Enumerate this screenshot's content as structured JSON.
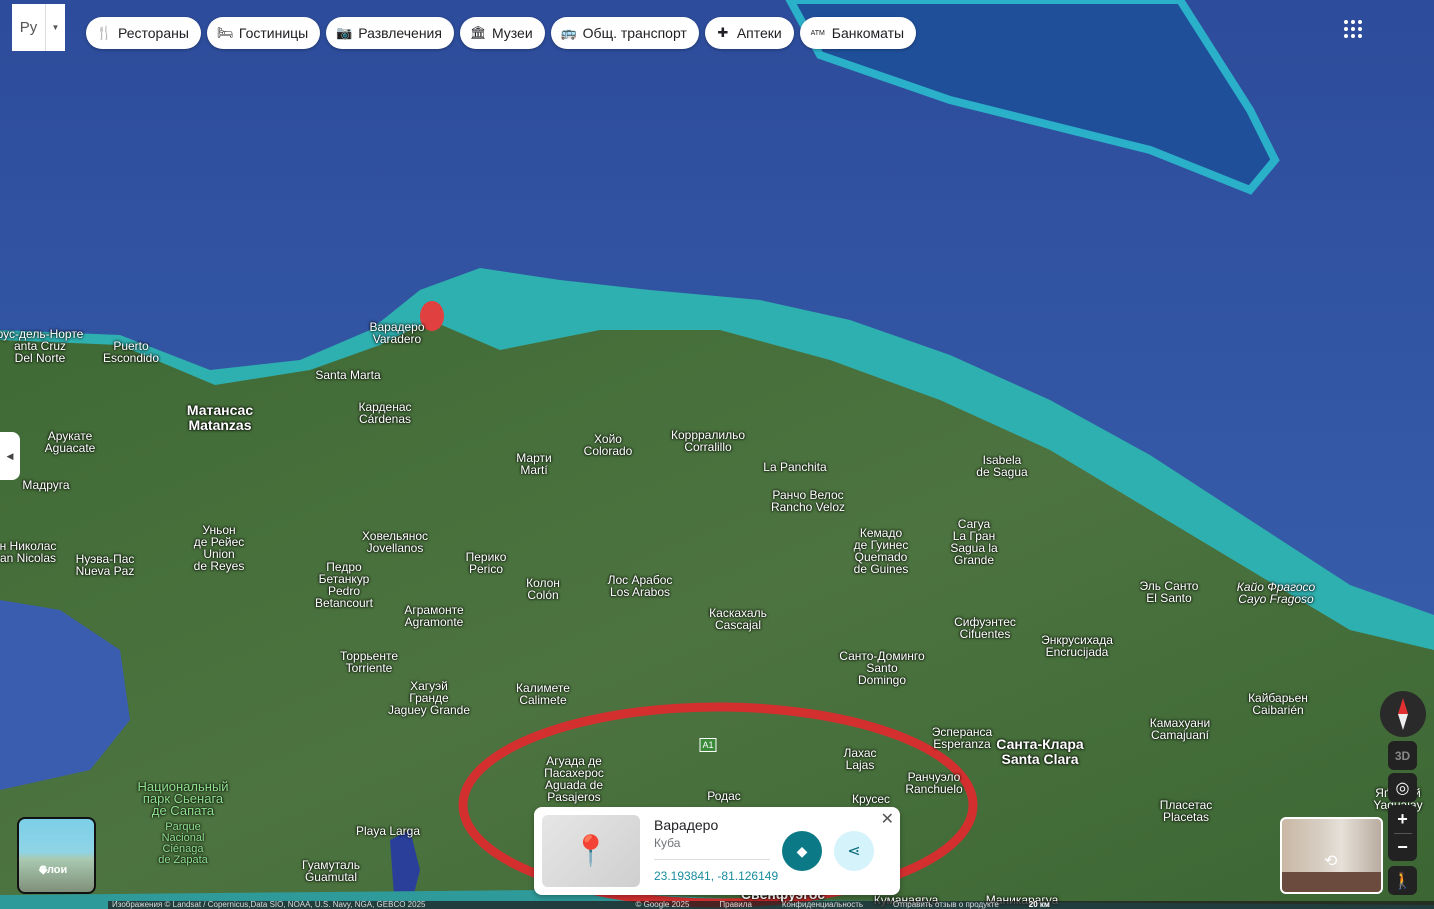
{
  "language": {
    "value": "Ру"
  },
  "categories": [
    {
      "label": "Рестораны",
      "icon": "fork-knife-icon"
    },
    {
      "label": "Гостиницы",
      "icon": "bed-icon"
    },
    {
      "label": "Развлечения",
      "icon": "camera-icon"
    },
    {
      "label": "Музеи",
      "icon": "museum-icon"
    },
    {
      "label": "Общ. транспорт",
      "icon": "bus-icon"
    },
    {
      "label": "Аптеки",
      "icon": "pharmacy-icon"
    },
    {
      "label": "Банкоматы",
      "icon": "atm-icon"
    }
  ],
  "labels": [
    "Варадеро\nVaradero",
    "Матансас\nMatanzas",
    "Santa Marta",
    "Карденас\nCárdenas",
    "Puerto\nEscondido",
    "Хойо\nColorado",
    "Коррралильо\nCorralillo",
    "Марти\nMartí",
    "La Panchita",
    "Isabela\nde Sagua",
    "Ранчо Велос\nRancho Veloz",
    "Кемадо\nде Гуинес\nQuemado\nde Guines",
    "Сагуа\nLa Гран\nSagua la\nGrande",
    "Арукате\nAguacate",
    "Мадруга",
    "Уньон\nде Рейес\nUnion\nde Reyes",
    "Нуэва-Пас\nNueva Paz",
    "Ховельянос\nJovellanos",
    "Педро\nБетанкур\nPedro\nBetancourt",
    "Перико\nPerico",
    "Колон\nColón",
    "Лос Арабос\nLos Arabos",
    "Аграмонте\nAgramonte",
    "Каскахаль\nCascajal",
    "Торрьенте\nTorriente",
    "Сифуэнтес\nCifuentes",
    "Эль Санто\nEl Santo",
    "Кайо Фрагосо\nCayo Fragoso",
    "Энкрусихада\nEncrucijada",
    "Санто-Доминго\nSanto\nDomingo",
    "Хагуэй\nГранде\nJaguey Grande",
    "Калимете\nCalimete",
    "Кайбарьен\nCaibarién",
    "Камахуани\nCamajuaní",
    "Эсперанса\nEsperanza",
    "Санта-Клара\nSanta Clara",
    "Лахас\nLajas",
    "Агуада де\nПасахерос\nAguada de\nPasajeros",
    "Родас",
    "Крусес",
    "Ранчуэло\nRanchuelo",
    "Пласетас\nPlacetas",
    "Playa Larga",
    "Гуамуталь\nGuamutal",
    "Сьенфуэгос",
    "Куманаягуа",
    "Маникарагуа",
    "Яґуахай\nYaguajay",
    "Национальный\nпарк Сьенага\nде Сапата",
    "Parque\nNacional\nCiénaga\nde Zapata",
    "рус-дель-Норте\nanta Cruz\nDel Norte",
    "н Николас\nan Nicolas",
    "A1"
  ],
  "layers_label": "Слои",
  "place_card": {
    "title": "Варадеро",
    "subtitle": "Куба",
    "coords": "23.193841, -81.126149"
  },
  "controls": {
    "three_d": "3D",
    "zoom_in": "+",
    "zoom_out": "−"
  },
  "attribution": {
    "imagery": "Изображения © Landsat / Copernicus,Data SIO, NOAA, U.S. Navy, NGA, GEBCO 2025",
    "copyright": "© Google 2025",
    "terms": "Правила",
    "privacy": "Конфиденциальность",
    "feedback": "Отправить отзыв о продукте",
    "scale": "20 км"
  },
  "colors": {
    "annotation": "#d32f2f",
    "accent": "#0b7a86"
  }
}
